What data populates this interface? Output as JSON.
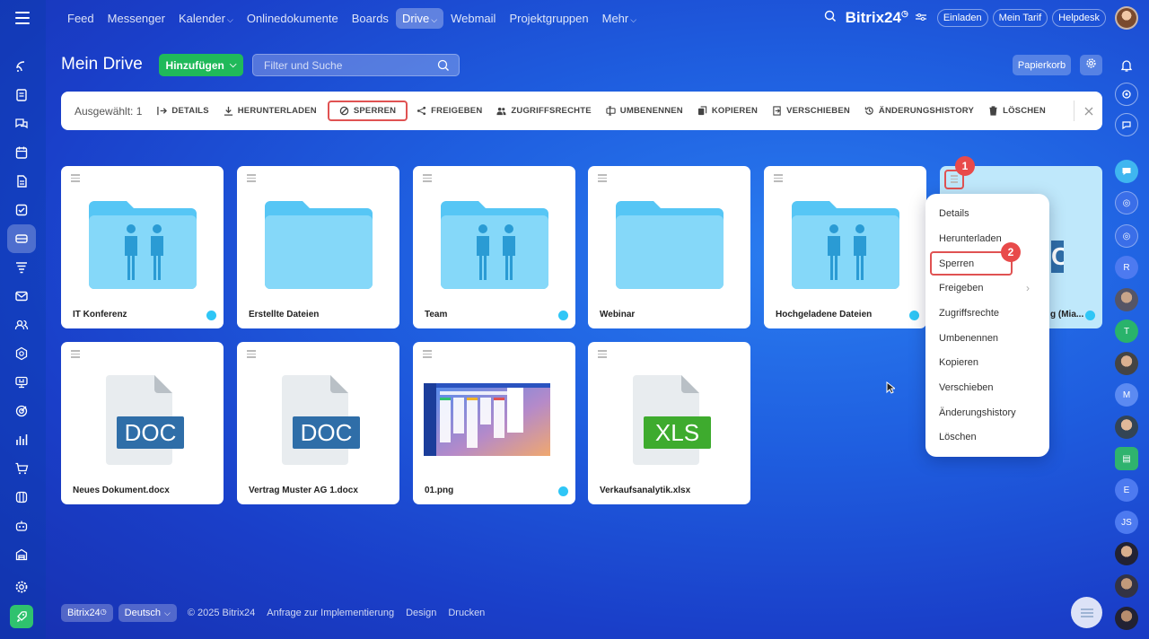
{
  "nav": {
    "items": [
      {
        "label": "Feed"
      },
      {
        "label": "Messenger"
      },
      {
        "label": "Kalender",
        "dropdown": true
      },
      {
        "label": "Onlinedokumente"
      },
      {
        "label": "Boards"
      },
      {
        "label": "Drive",
        "dropdown": true,
        "active": true
      },
      {
        "label": "Webmail"
      },
      {
        "label": "Projektgruppen"
      },
      {
        "label": "Mehr",
        "dropdown": true
      }
    ],
    "logo": "Bitrix24",
    "invite": "Einladen",
    "plan": "Mein Tarif",
    "help": "Helpdesk"
  },
  "page": {
    "title": "Mein Drive",
    "add_button": "Hinzufügen",
    "search_placeholder": "Filter und Suche",
    "trash": "Papierkorb"
  },
  "action_bar": {
    "selected": "Ausgewählt: 1",
    "actions": [
      {
        "label": "DETAILS",
        "icon": "details-icon"
      },
      {
        "label": "HERUNTERLADEN",
        "icon": "download-icon"
      },
      {
        "label": "SPERREN",
        "icon": "lock-icon"
      },
      {
        "label": "FREIGEBEN",
        "icon": "share-icon"
      },
      {
        "label": "ZUGRIFFSRECHTE",
        "icon": "users-icon"
      },
      {
        "label": "UMBENENNEN",
        "icon": "rename-icon"
      },
      {
        "label": "KOPIEREN",
        "icon": "copy-icon"
      },
      {
        "label": "VERSCHIEBEN",
        "icon": "move-icon"
      },
      {
        "label": "ÄNDERUNGSHISTORY",
        "icon": "history-icon"
      },
      {
        "label": "LÖSCHEN",
        "icon": "trash-icon"
      }
    ]
  },
  "files": [
    {
      "name": "IT Konferenz",
      "type": "shared-folder",
      "shared": true
    },
    {
      "name": "Erstellte Dateien",
      "type": "folder",
      "shared": false
    },
    {
      "name": "Team",
      "type": "shared-folder",
      "shared": true
    },
    {
      "name": "Webinar",
      "type": "folder",
      "shared": false
    },
    {
      "name": "Hochgeladene Dateien",
      "type": "shared-folder",
      "shared": true
    },
    {
      "name": "g (Mia...",
      "type": "doc",
      "shared": true,
      "selected": true,
      "ext": "C"
    },
    {
      "name": "Neues Dokument.docx",
      "type": "doc",
      "ext": "DOC",
      "shared": false
    },
    {
      "name": "Vertrag Muster AG 1.docx",
      "type": "doc",
      "ext": "DOC",
      "shared": false
    },
    {
      "name": "01.png",
      "type": "image",
      "shared": true
    },
    {
      "name": "Verkaufsanalytik.xlsx",
      "type": "xls",
      "ext": "XLS",
      "shared": false
    }
  ],
  "context_menu": {
    "items": [
      {
        "label": "Details"
      },
      {
        "label": "Herunterladen"
      },
      {
        "label": "Sperren"
      },
      {
        "label": "Freigeben",
        "submenu": true
      },
      {
        "label": "Zugriffsrechte"
      },
      {
        "label": "Umbenennen"
      },
      {
        "label": "Kopieren"
      },
      {
        "label": "Verschieben"
      },
      {
        "label": "Änderungshistory"
      },
      {
        "label": "Löschen"
      }
    ]
  },
  "badges": [
    "1",
    "2"
  ],
  "right_bar": {
    "initials": [
      "R",
      "T",
      "M",
      "E",
      "JS"
    ]
  },
  "footer": {
    "brand": "Bitrix24",
    "language": "Deutsch",
    "copyright": "© 2025 Bitrix24",
    "links": [
      "Anfrage zur Implementierung",
      "Design",
      "Drucken"
    ]
  },
  "colors": {
    "accent_green": "#20b95a",
    "highlight_red": "#e05252",
    "badge_red": "#e84a4a",
    "folder_blue": "#7fd4f7",
    "doc_blue": "#2f6ea8",
    "xls_green": "#3eab2e"
  }
}
